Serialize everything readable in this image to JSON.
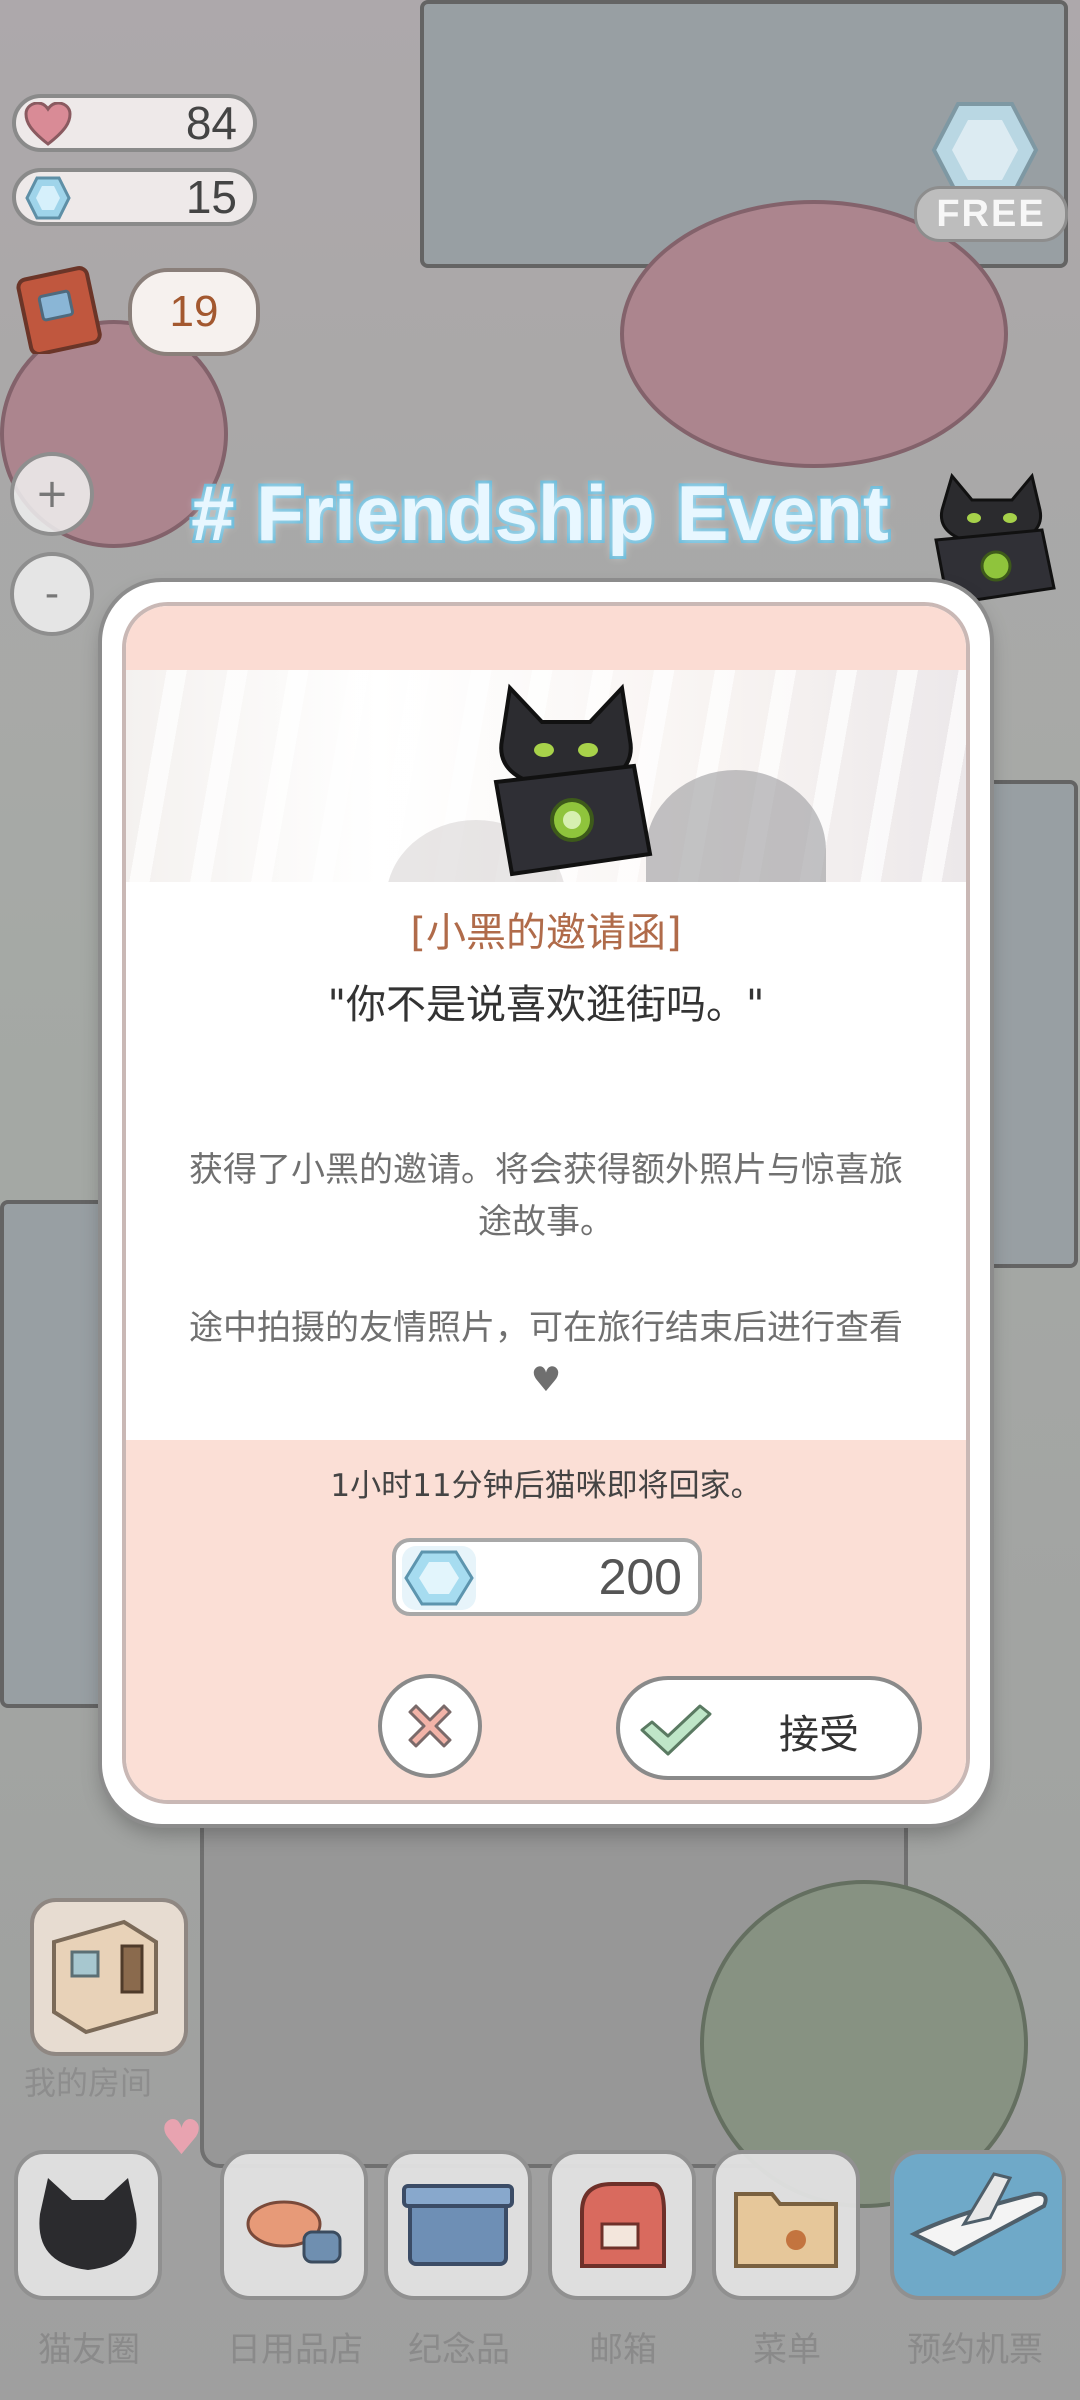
{
  "hud": {
    "hearts": "84",
    "gems": "15",
    "bubble_count": "19",
    "free_label": "FREE",
    "zoom_in": "+",
    "zoom_out": "-"
  },
  "event": {
    "title": "# Friendship Event"
  },
  "dialog": {
    "invite_title": "[小黑的邀请函]",
    "quote": "\"你不是说喜欢逛街吗。\"",
    "desc_line1": "获得了小黑的邀请。将会获得额外照片与惊喜旅",
    "desc_line2": "途故事。",
    "desc_line3": "途中拍摄的友情照片，可在旅行结束后进行查看",
    "desc_heart": "♥",
    "timer": "1小时11分钟后猫咪即将回家。",
    "cost": "200",
    "accept_label": "接受"
  },
  "room": {
    "label": "我的房间"
  },
  "bottom_nav": [
    {
      "label": "猫友圈",
      "icon": "cat-circle-icon"
    },
    {
      "label": "日用品店",
      "icon": "shop-icon"
    },
    {
      "label": "纪念品",
      "icon": "souvenir-box-icon"
    },
    {
      "label": "邮箱",
      "icon": "mailbox-icon"
    },
    {
      "label": "菜单",
      "icon": "menu-folder-icon"
    },
    {
      "label": "预约机票",
      "icon": "airplane-icon"
    }
  ],
  "colors": {
    "accent_title": "#b06b4a",
    "event_title_outline": "#66b9d9",
    "dialog_bg_pink": "#fbdfd6"
  }
}
